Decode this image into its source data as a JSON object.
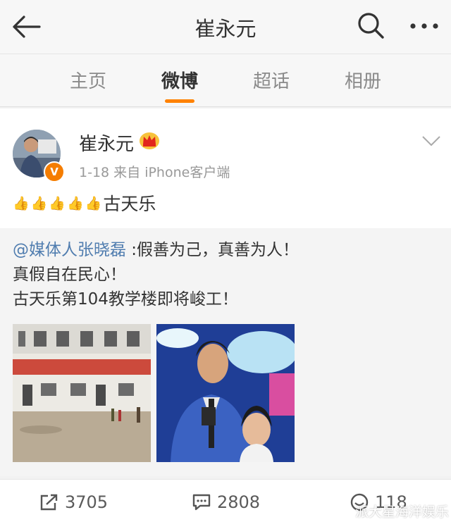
{
  "header": {
    "title": "崔永元",
    "back_icon": "back-arrow-icon",
    "search_icon": "search-icon",
    "more_icon": "more-icon"
  },
  "tabs": [
    {
      "label": "主页",
      "active": false
    },
    {
      "label": "微博",
      "active": true
    },
    {
      "label": "超话",
      "active": false
    },
    {
      "label": "相册",
      "active": false
    }
  ],
  "colors": {
    "accent": "#ff8200",
    "link": "#507daf",
    "verified": "#f57d00"
  },
  "post": {
    "username": "崔永元",
    "meta": "1-18  来自 iPhone客户端",
    "thumbs": [
      "👍",
      "👍",
      "👍",
      "👍",
      "👍"
    ],
    "text": "古天乐",
    "repost": {
      "mention": "@媒体人张晓磊",
      "line1_rest": " :假善为己，真善为人！",
      "line2": "真假自在民心！",
      "line3": "古天乐第104教学楼即将峻工！"
    }
  },
  "footer": {
    "repost_count": "3705",
    "comment_count": "2808",
    "like_count": "118"
  },
  "watermark": {
    "text": "派大星海洋娱乐"
  }
}
